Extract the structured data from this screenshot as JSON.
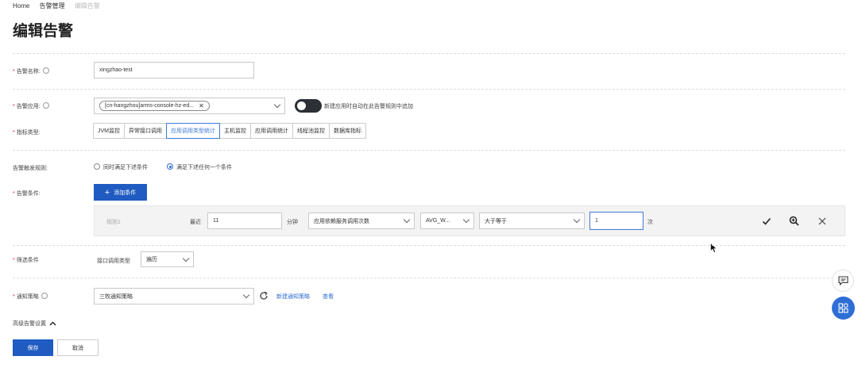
{
  "breadcrumb": {
    "home": "Home",
    "alerts": "告警管理",
    "current": "编辑告警"
  },
  "page_title": "编辑告警",
  "form": {
    "name_label": "告警名称:",
    "name_value": "xingzhao-test",
    "app_label": "告警应用:",
    "app_tag": "[cn-hangzhou]arms-console-hz-ed...",
    "toggle_label": "新建应用时自动在此告警规则中追加",
    "metric_label": "指标类型:",
    "metric_tabs": [
      "JVM监控",
      "异常接口调用",
      "应用调用类型统计",
      "主机监控",
      "应用调用统计",
      "线程池监控",
      "数据库指标"
    ],
    "trigger_label": "告警触发规则:",
    "trigger_options": [
      "同时满足下述条件",
      "满足下述任何一个条件"
    ],
    "condition_label": "告警条件:",
    "add_condition": "添加条件",
    "rule": {
      "name": "规则1",
      "recent_label": "最近",
      "minutes_value": "11",
      "minutes_unit": "分钟",
      "metric_select": "应用依赖服务调用次数",
      "agg_select": "AVG_W...",
      "op_select": "大于等于",
      "threshold_value": "1",
      "count_unit": "次"
    },
    "filter_label": "筛选条件",
    "filter_sub_label": "接口调用类型",
    "filter_select": "遍历",
    "notify_label": "通知策略",
    "notify_select": "三牧通知策略",
    "new_policy_link": "新建通知策略",
    "view_link": "查看",
    "advanced_label": "高级告警设置",
    "save_button": "保存",
    "cancel_button": "取消"
  },
  "colors": {
    "primary": "#1f5bc1",
    "link": "#2e6bd0",
    "toggle": "#2b2f36"
  }
}
